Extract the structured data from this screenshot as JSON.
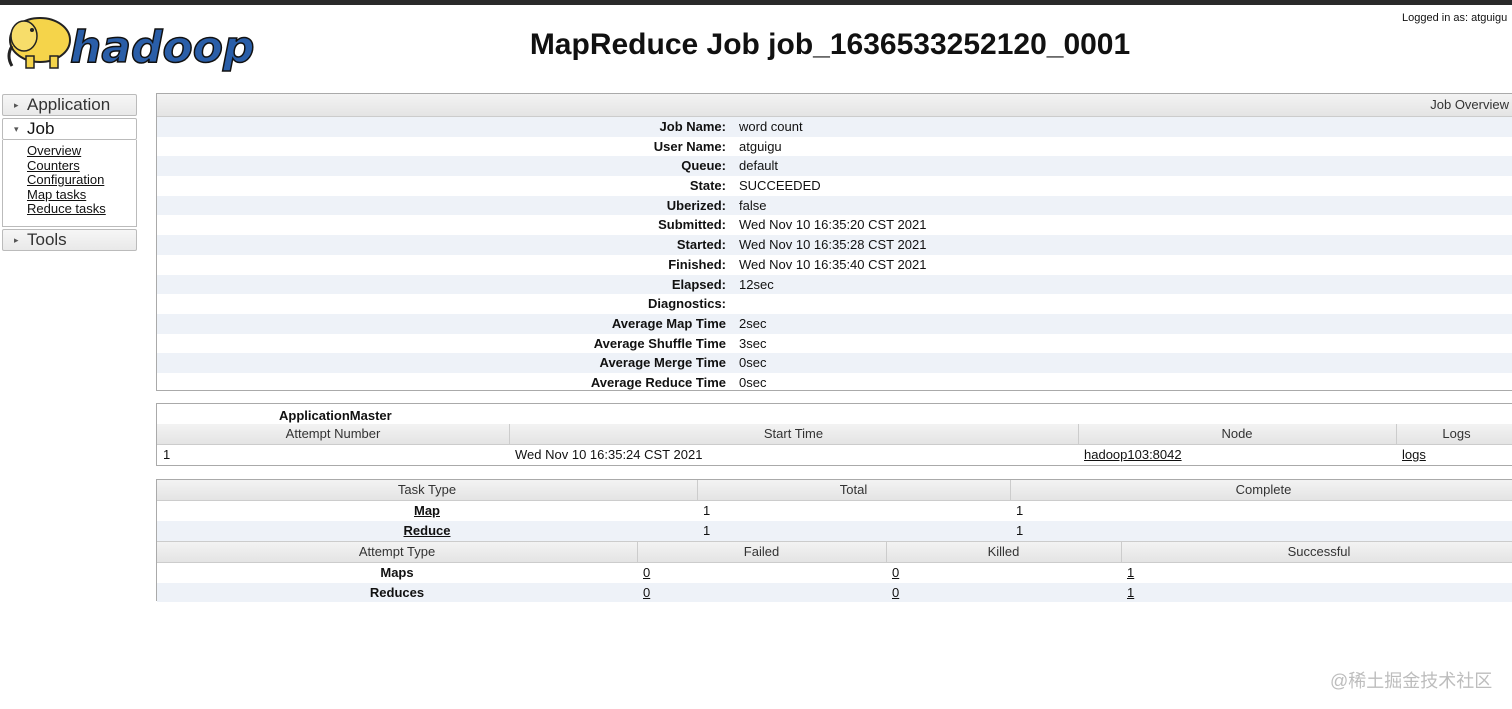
{
  "header": {
    "logo_text": "hadoop",
    "logged_in": "Logged in as: atguigu",
    "title": "MapReduce Job job_1636533252120_0001"
  },
  "sidebar": {
    "application": "Application",
    "job": "Job",
    "job_links": [
      "Overview",
      "Counters",
      "Configuration",
      "Map tasks",
      "Reduce tasks"
    ],
    "tools": "Tools"
  },
  "overview": {
    "title": "Job Overview",
    "rows": [
      {
        "key": "Job Name:",
        "value": "word count"
      },
      {
        "key": "User Name:",
        "value": "atguigu"
      },
      {
        "key": "Queue:",
        "value": "default"
      },
      {
        "key": "State:",
        "value": "SUCCEEDED"
      },
      {
        "key": "Uberized:",
        "value": "false"
      },
      {
        "key": "Submitted:",
        "value": "Wed Nov 10 16:35:20 CST 2021"
      },
      {
        "key": "Started:",
        "value": "Wed Nov 10 16:35:28 CST 2021"
      },
      {
        "key": "Finished:",
        "value": "Wed Nov 10 16:35:40 CST 2021"
      },
      {
        "key": "Elapsed:",
        "value": "12sec"
      },
      {
        "key": "Diagnostics:",
        "value": ""
      },
      {
        "key": "Average Map Time",
        "value": "2sec"
      },
      {
        "key": "Average Shuffle Time",
        "value": "3sec"
      },
      {
        "key": "Average Merge Time",
        "value": "0sec"
      },
      {
        "key": "Average Reduce Time",
        "value": "0sec"
      }
    ]
  },
  "app_master": {
    "caption": "ApplicationMaster",
    "columns": [
      "Attempt Number",
      "Start Time",
      "Node",
      "Logs"
    ],
    "row": {
      "attempt": "1",
      "start_time": "Wed Nov 10 16:35:24 CST 2021",
      "node": "hadoop103:8042",
      "logs": "logs"
    }
  },
  "tasks": {
    "columns": [
      "Task Type",
      "Total",
      "Complete"
    ],
    "rows": [
      {
        "type": "Map",
        "total": "1",
        "complete": "1"
      },
      {
        "type": "Reduce",
        "total": "1",
        "complete": "1"
      }
    ]
  },
  "attempts": {
    "columns": [
      "Attempt Type",
      "Failed",
      "Killed",
      "Successful"
    ],
    "rows": [
      {
        "type": "Maps",
        "failed": "0",
        "killed": "0",
        "successful": "1"
      },
      {
        "type": "Reduces",
        "failed": "0",
        "killed": "0",
        "successful": "1"
      }
    ]
  },
  "watermark": "@稀土掘金技术社区",
  "colors": {
    "stripe": "#eef2f8",
    "header_bg": "#e9e9e9",
    "logo_yellow": "#f5d44a",
    "logo_blue": "#2a5ea8"
  }
}
